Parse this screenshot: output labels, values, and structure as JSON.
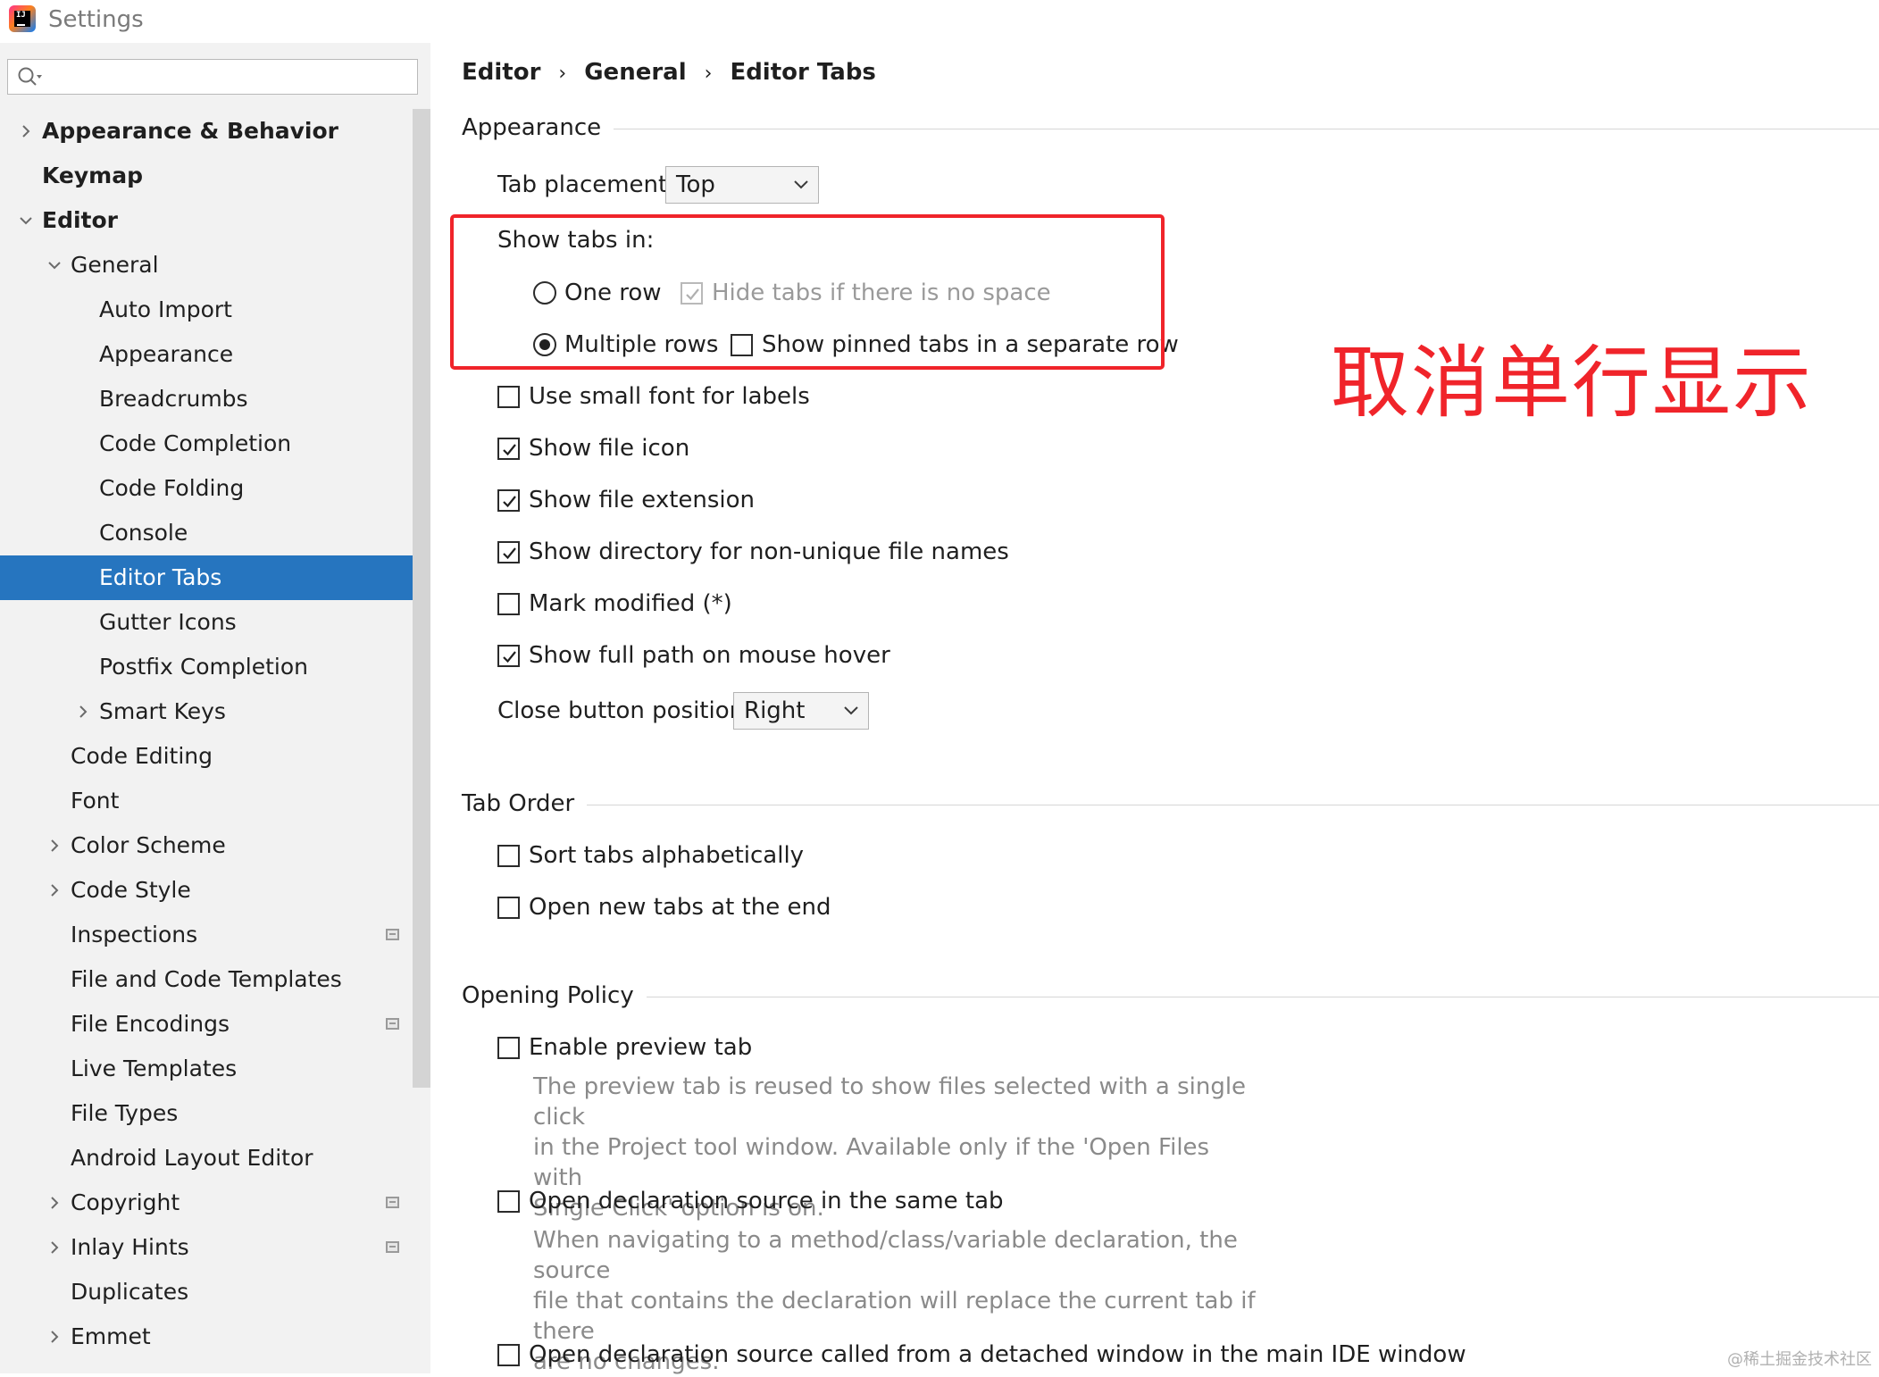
{
  "window": {
    "title": "Settings",
    "app_icon": "intellij-idea-icon",
    "app_icon_text": "IJ"
  },
  "sidebar": {
    "search": {
      "value": "",
      "placeholder": ""
    },
    "items": [
      {
        "label": "Appearance & Behavior",
        "level": 0,
        "bold": true,
        "arrow": "right"
      },
      {
        "label": "Keymap",
        "level": 0,
        "bold": true,
        "arrow": "none"
      },
      {
        "label": "Editor",
        "level": 0,
        "bold": true,
        "arrow": "down"
      },
      {
        "label": "General",
        "level": 1,
        "bold": false,
        "arrow": "down"
      },
      {
        "label": "Auto Import",
        "level": 2,
        "bold": false,
        "arrow": "none"
      },
      {
        "label": "Appearance",
        "level": 2,
        "bold": false,
        "arrow": "none"
      },
      {
        "label": "Breadcrumbs",
        "level": 2,
        "bold": false,
        "arrow": "none"
      },
      {
        "label": "Code Completion",
        "level": 2,
        "bold": false,
        "arrow": "none"
      },
      {
        "label": "Code Folding",
        "level": 2,
        "bold": false,
        "arrow": "none"
      },
      {
        "label": "Console",
        "level": 2,
        "bold": false,
        "arrow": "none"
      },
      {
        "label": "Editor Tabs",
        "level": 2,
        "bold": false,
        "arrow": "none",
        "selected": true
      },
      {
        "label": "Gutter Icons",
        "level": 2,
        "bold": false,
        "arrow": "none"
      },
      {
        "label": "Postfix Completion",
        "level": 2,
        "bold": false,
        "arrow": "none"
      },
      {
        "label": "Smart Keys",
        "level": 2,
        "bold": false,
        "arrow": "right"
      },
      {
        "label": "Code Editing",
        "level": 1,
        "bold": false,
        "arrow": "none"
      },
      {
        "label": "Font",
        "level": 1,
        "bold": false,
        "arrow": "none"
      },
      {
        "label": "Color Scheme",
        "level": 1,
        "bold": false,
        "arrow": "right"
      },
      {
        "label": "Code Style",
        "level": 1,
        "bold": false,
        "arrow": "right"
      },
      {
        "label": "Inspections",
        "level": 1,
        "bold": false,
        "arrow": "none",
        "project_icon": true
      },
      {
        "label": "File and Code Templates",
        "level": 1,
        "bold": false,
        "arrow": "none"
      },
      {
        "label": "File Encodings",
        "level": 1,
        "bold": false,
        "arrow": "none",
        "project_icon": true
      },
      {
        "label": "Live Templates",
        "level": 1,
        "bold": false,
        "arrow": "none"
      },
      {
        "label": "File Types",
        "level": 1,
        "bold": false,
        "arrow": "none"
      },
      {
        "label": "Android Layout Editor",
        "level": 1,
        "bold": false,
        "arrow": "none"
      },
      {
        "label": "Copyright",
        "level": 1,
        "bold": false,
        "arrow": "right",
        "project_icon": true
      },
      {
        "label": "Inlay Hints",
        "level": 1,
        "bold": false,
        "arrow": "right",
        "project_icon": true
      },
      {
        "label": "Duplicates",
        "level": 1,
        "bold": false,
        "arrow": "none"
      },
      {
        "label": "Emmet",
        "level": 1,
        "bold": false,
        "arrow": "right"
      }
    ]
  },
  "breadcrumb": [
    "Editor",
    "General",
    "Editor Tabs"
  ],
  "breadcrumb_separator": "›",
  "appearance": {
    "title": "Appearance",
    "tab_placement_label": "Tab placement:",
    "tab_placement_value": "Top",
    "show_tabs_in_label": "Show tabs in:",
    "one_row": {
      "label": "One row",
      "selected": false
    },
    "hide_tabs": {
      "label": "Hide tabs if there is no space",
      "checked": true,
      "disabled": true
    },
    "multiple_rows": {
      "label": "Multiple rows",
      "selected": true
    },
    "pinned_separate": {
      "label": "Show pinned tabs in a separate row",
      "checked": false
    },
    "small_font": {
      "label": "Use small font for labels",
      "checked": false
    },
    "file_icon": {
      "label": "Show file icon",
      "checked": true
    },
    "file_extension": {
      "label": "Show file extension",
      "checked": true
    },
    "directory": {
      "label": "Show directory for non-unique file names",
      "checked": true
    },
    "mark_modified": {
      "label": "Mark modified (*)",
      "checked": false
    },
    "full_path": {
      "label": "Show full path on mouse hover",
      "checked": true
    },
    "close_button_label": "Close button position:",
    "close_button_value": "Right"
  },
  "tab_order": {
    "title": "Tab Order",
    "sort_alpha": {
      "label": "Sort tabs alphabetically",
      "checked": false
    },
    "open_end": {
      "label": "Open new tabs at the end",
      "checked": false
    }
  },
  "opening_policy": {
    "title": "Opening Policy",
    "preview_tab": {
      "label": "Enable preview tab",
      "checked": false
    },
    "preview_desc": [
      "The preview tab is reused to show files selected with a single click",
      "in the Project tool window. Available only if the 'Open Files with",
      "Single Click' option is on."
    ],
    "same_tab": {
      "label": "Open declaration source in the same tab",
      "checked": false
    },
    "same_tab_desc": [
      "When navigating to a method/class/variable declaration, the source",
      "file that contains the declaration will replace the current tab if there",
      "are no changes."
    ],
    "detached": {
      "label": "Open declaration source called from a detached window in the main IDE window",
      "checked": false
    }
  },
  "annotation": {
    "text": "取消单行显示",
    "color": "#f0242a"
  },
  "watermark": "@稀土掘金技术社区",
  "colors": {
    "selection": "#2675bf",
    "sidebar_bg": "#f2f2f2",
    "annotation": "#f0242a"
  }
}
